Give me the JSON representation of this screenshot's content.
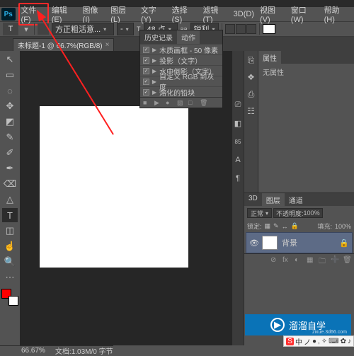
{
  "menu": {
    "items": [
      "文件(F)",
      "编辑(E)",
      "图像(I)",
      "图层(L)",
      "文字(Y)",
      "选择(S)",
      "滤镜(T)",
      "3D(D)",
      "视图(V)",
      "窗口(W)",
      "帮助(H)"
    ]
  },
  "options": {
    "tool_glyph": "T",
    "font_family": "方正粗活意...",
    "font_style": "-",
    "font_size_label": "T",
    "font_size": "48 点",
    "aa_label": "aa",
    "aa_mode": "锐利"
  },
  "doc_tab": {
    "title": "未标题-1 @ 66.7%(RGB/8)",
    "close": "×"
  },
  "tools": [
    "↖",
    "▭",
    "◌",
    "✥",
    "◩",
    "✎",
    "✐",
    "✒",
    "⌫",
    "△",
    "T",
    "◫",
    "☝",
    "🔍",
    "⋯"
  ],
  "mid_icons": [
    "⎚",
    "◧",
    "85",
    "A",
    "¶"
  ],
  "history_panel": {
    "tabs": [
      "历史记录",
      "动作"
    ],
    "items": [
      "木质画框 - 50 像素",
      "投影（文字）",
      "水中倒影（文字）",
      "自定义 RGB 到灰度",
      "熔化的铅块"
    ],
    "bottom_icons": [
      "■",
      "▶",
      "●",
      "▧",
      "□",
      "🗑"
    ]
  },
  "right_strip_icons": [
    "⎘",
    "❖",
    "⎙",
    "☷"
  ],
  "properties": {
    "tab": "属性",
    "body": "无属性"
  },
  "layers": {
    "tabs": [
      "3D",
      "图层",
      "通道"
    ],
    "kind": "正常",
    "opacity_label": "不透明度:",
    "opacity": "100%",
    "lock_label": "锁定:",
    "lock_icons": [
      "▦",
      "✎",
      "↔",
      "🔒"
    ],
    "fill_label": "填充:",
    "fill": "100%",
    "layer_name": "背景",
    "layer_locked": "🔒",
    "bottom_icons": [
      "⊘",
      "fx",
      "◐",
      "▦",
      "🗀",
      "➕",
      "🗑"
    ]
  },
  "status": {
    "zoom": "66.67%",
    "docinfo": "文档:1.03M/0 字节"
  },
  "watermark": {
    "brand": "溜溜自学",
    "url": "zixue.3d66.com"
  },
  "ime": {
    "items": [
      "S",
      "中",
      "ノ",
      "●",
      ",",
      "✧",
      "⌨",
      "✿",
      "♪"
    ]
  }
}
